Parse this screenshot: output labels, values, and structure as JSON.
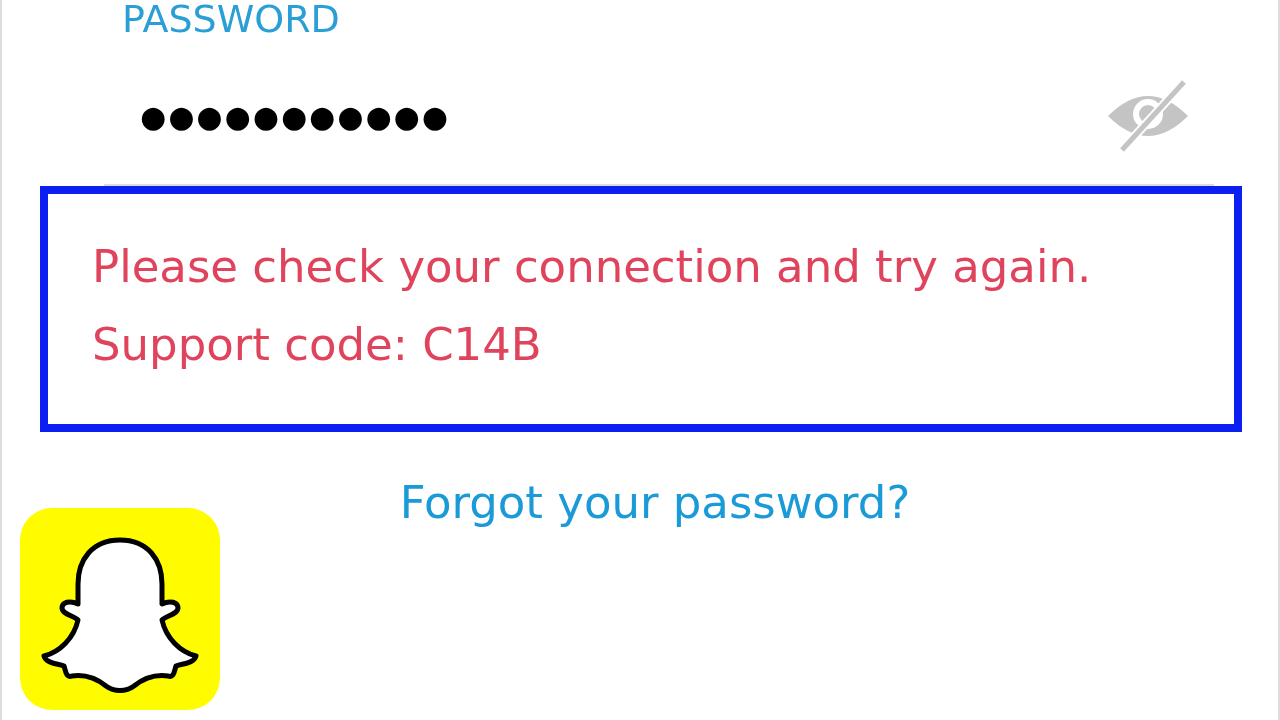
{
  "password_field": {
    "label": "PASSWORD",
    "value": "●●●●●●●●●●●",
    "masked": true
  },
  "error_message": {
    "lines": [
      "Please check your connection and try again.",
      "Support code: C14B"
    ],
    "highlighted": true
  },
  "forgot_link": "Forgot your password?",
  "app_logo": {
    "kind": "ghost"
  }
}
